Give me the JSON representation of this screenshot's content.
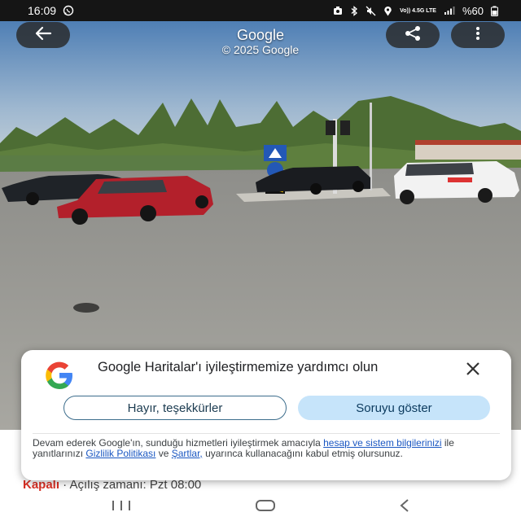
{
  "status_bar": {
    "time": "16:09",
    "network": "Vo)) 4.5G LTE",
    "battery": "%60",
    "icons": [
      "whatsapp-icon",
      "notification-icon",
      "bluetooth-icon",
      "mute-icon",
      "location-icon",
      "signal-icon",
      "battery-icon"
    ]
  },
  "viewer": {
    "title": "Google",
    "subtitle": "© 2025 Google",
    "back_icon": "back-arrow-icon",
    "share_icon": "share-icon",
    "more_icon": "more-vert-icon"
  },
  "place": {
    "status": "Kapalı",
    "separator": " · ",
    "hours": "Açılış zamanı: Pzt 08:00"
  },
  "dialog": {
    "title": "Google Haritalar'ı iyileştirmemize yardımcı olun",
    "decline_label": "Hayır, teşekkürler",
    "accept_label": "Soruyu göster",
    "legal_1": "Devam ederek Google'ın, sunduğu hizmetleri iyileştirmek amacıyla ",
    "legal_link_1": "hesap ve sistem bilgilerinizi",
    "legal_2": " ile yanıtlarınızı ",
    "legal_link_2": "Gizlilik Politikası",
    "legal_3": " ve ",
    "legal_link_3": "Şartlar,",
    "legal_4": " uyarınca kullanacağını kabul etmiş olursunuz."
  },
  "colors": {
    "closed": "#d93025",
    "link": "#1a57c2",
    "accept_bg": "#c6e4fa",
    "decline_border": "#3c6d8c"
  }
}
